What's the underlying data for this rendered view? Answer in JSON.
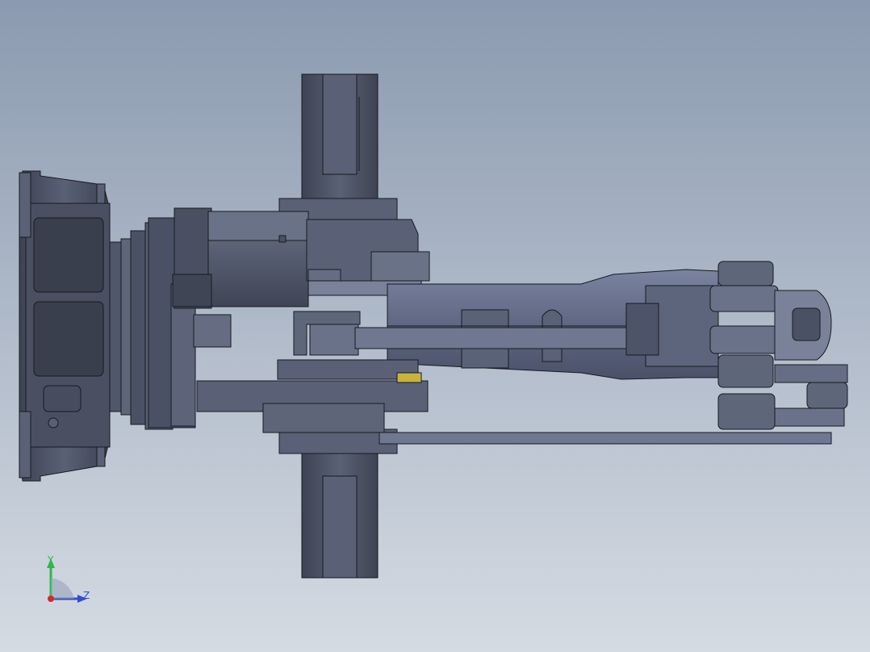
{
  "viewport": {
    "background_top": "#8b9ab0",
    "background_bottom": "#d5dbe3"
  },
  "model": {
    "part_fill": "#4f5668",
    "part_light": "#6b7388",
    "part_lighter": "#7f88a0",
    "part_dark": "#3c4252",
    "edge_color": "#161a22",
    "accent_yellow": "#c8b43c"
  },
  "triad": {
    "y_label": "Y",
    "z_label": "Z",
    "y_color": "#2db84a",
    "z_color": "#2f4fd0",
    "x_color": "#d02a2a"
  }
}
